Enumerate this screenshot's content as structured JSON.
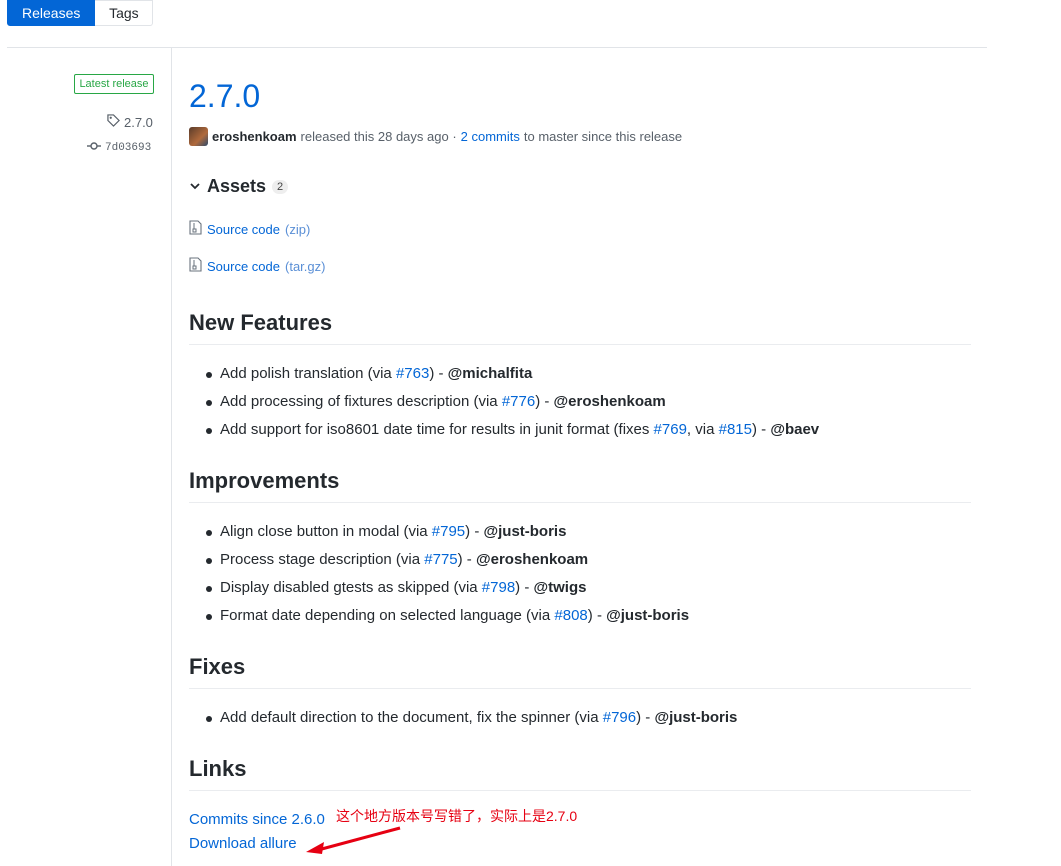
{
  "tabs": {
    "releases": "Releases",
    "tags": "Tags"
  },
  "sidebar": {
    "badge": "Latest release",
    "tag": "2.7.0",
    "commit": "7d03693"
  },
  "release": {
    "title": "2.7.0",
    "author": "eroshenkoam",
    "released_text": "released this 28 days ago ·",
    "commits_link": "2 commits",
    "commits_tail": "to master since this release"
  },
  "assets": {
    "label": "Assets",
    "count": "2",
    "items": [
      {
        "name": "Source code",
        "ext": "(zip)"
      },
      {
        "name": "Source code",
        "ext": "(tar.gz)"
      }
    ]
  },
  "sections": {
    "features": {
      "heading": "New Features",
      "items": [
        {
          "pre": "Add polish translation (via ",
          "l1": "#763",
          "post": ") - ",
          "user": "@michalfita"
        },
        {
          "pre": "Add processing of fixtures description (via ",
          "l1": "#776",
          "post": ") - ",
          "user": "@eroshenkoam"
        },
        {
          "pre": "Add support for iso8601 date time for results in junit format (fixes ",
          "l1": "#769",
          "mid": ", via ",
          "l2": "#815",
          "post": ") - ",
          "user": "@baev"
        }
      ]
    },
    "improvements": {
      "heading": "Improvements",
      "items": [
        {
          "pre": "Align close button in modal (via ",
          "l1": "#795",
          "post": ") - ",
          "user": "@just-boris"
        },
        {
          "pre": "Process stage description (via ",
          "l1": "#775",
          "post": ") - ",
          "user": "@eroshenkoam"
        },
        {
          "pre": "Display disabled gtests as skipped (via ",
          "l1": "#798",
          "post": ") - ",
          "user": "@twigs"
        },
        {
          "pre": "Format date depending on selected language (via ",
          "l1": "#808",
          "post": ") - ",
          "user": "@just-boris"
        }
      ]
    },
    "fixes": {
      "heading": "Fixes",
      "items": [
        {
          "pre": "Add default direction to the document, fix the spinner (via ",
          "l1": "#796",
          "post": ") - ",
          "user": "@just-boris"
        }
      ]
    },
    "links": {
      "heading": "Links",
      "commits_since": "Commits since 2.6.0",
      "download": "Download allure"
    }
  },
  "annotation": {
    "text": "这个地方版本号写错了，实际上是2.7.0",
    "color": "#e60012"
  }
}
